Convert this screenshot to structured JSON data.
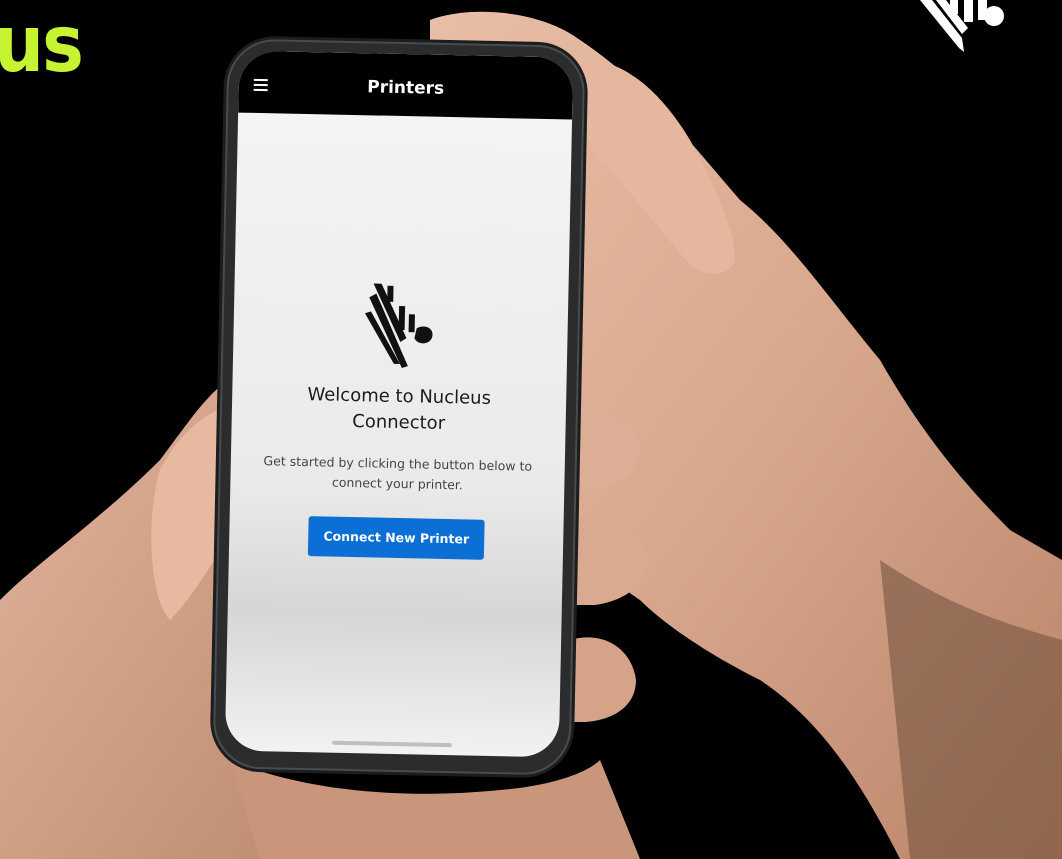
{
  "brand": {
    "partial_text": "us",
    "accent_color": "#c6f432"
  },
  "icons": {
    "corner_logo": "zebra-logo-icon",
    "menu": "hamburger-menu-icon",
    "app_logo": "zebra-logo-icon"
  },
  "app": {
    "header_title": "Printers",
    "welcome_title": "Welcome to Nucleus Connector",
    "welcome_description": "Get started by clicking the button below to connect your printer.",
    "connect_button_label": "Connect New Printer",
    "button_color": "#0b6fd6"
  }
}
